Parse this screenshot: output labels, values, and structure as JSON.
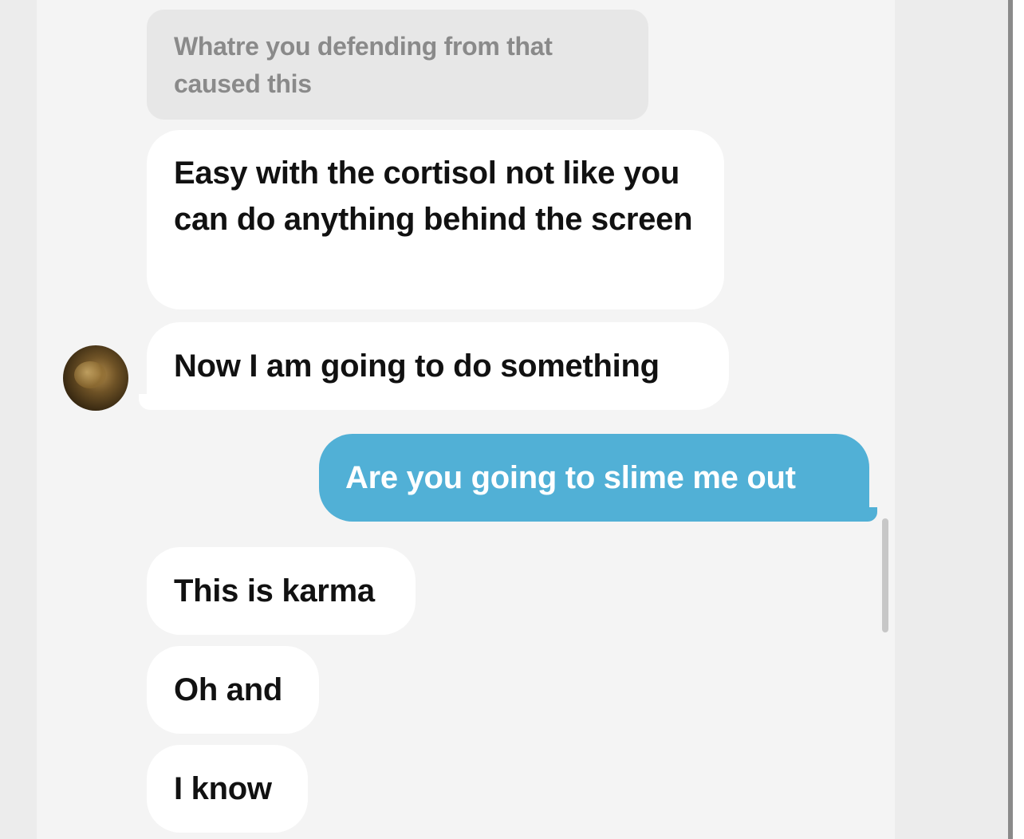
{
  "conversation": {
    "quoted_reply": "Whatre you defending from that caused this",
    "messages": [
      {
        "sender": "them",
        "text": "Easy with the cortisol not like you can do anything behind the screen"
      },
      {
        "sender": "them",
        "text": "Now I am going to do something"
      },
      {
        "sender": "me",
        "text": "Are you going to slime me out"
      },
      {
        "sender": "them",
        "text": "This is karma"
      },
      {
        "sender": "them",
        "text": "Oh and"
      },
      {
        "sender": "them",
        "text": "I know"
      }
    ]
  },
  "contact": {
    "avatar_icon": "user-avatar-photo"
  },
  "colors": {
    "outgoing_bubble": "#51b0d6",
    "incoming_bubble": "#ffffff",
    "quoted_bubble": "#e7e7e7",
    "background": "#f4f4f4"
  }
}
